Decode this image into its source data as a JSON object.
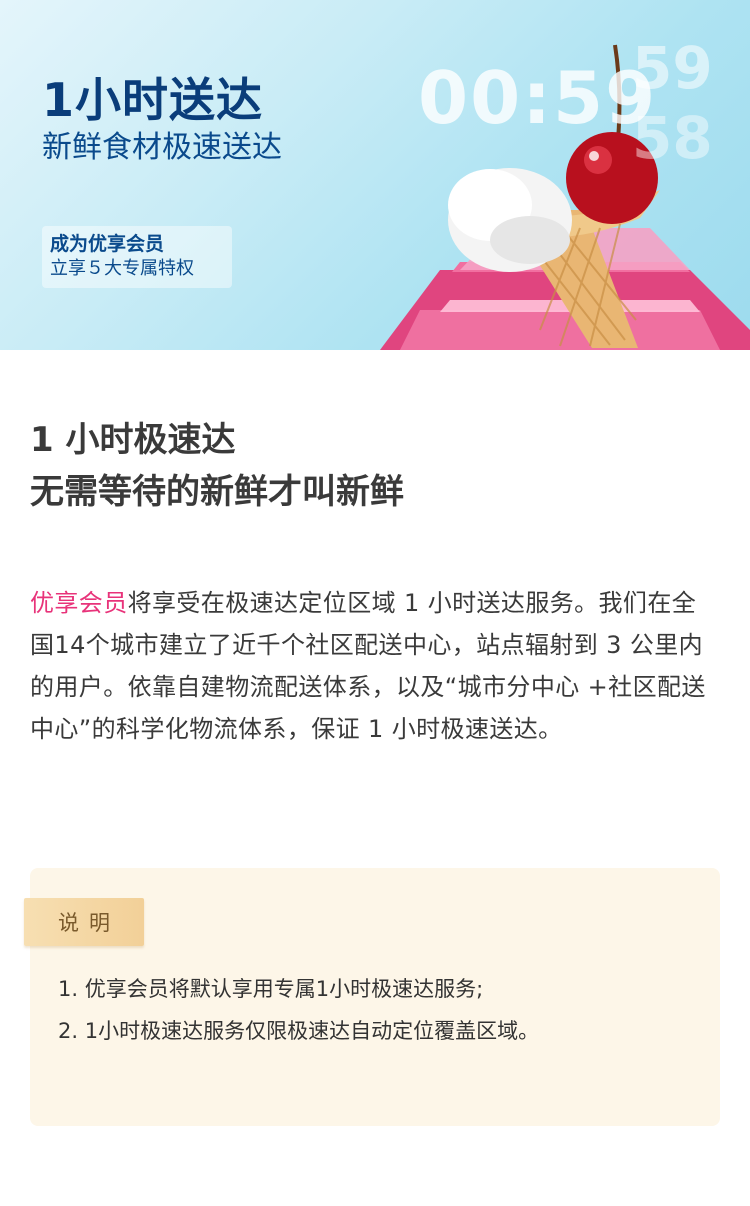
{
  "hero": {
    "title": "1小时送达",
    "subtitle": "新鲜食材极速送达",
    "member_line1": "成为优享会员",
    "member_line2": "立享５大专属特权",
    "timer": "00:59",
    "timer_next_top": "59",
    "timer_next_bottom": "58"
  },
  "main": {
    "headline_line1": "1 小时极速达",
    "headline_line2": "无需等待的新鲜才叫新鲜",
    "body_accent": "优享会员",
    "body_rest": "将享受在极速达定位区域 1 小时送达服务。我们在全国14个城市建立了近千个社区配送中心，站点辐射到 3 公里内的用户。依靠自建物流配送体系，以及“城市分中心 +社区配送中心”的科学化物流体系，保证 1 小时极速送达。"
  },
  "note": {
    "tag": "说明",
    "items": [
      "1. 优享会员将默认享用专属1小时极速达服务;",
      "2. 1小时极速达服务仅限极速达自动定位覆盖区域。"
    ]
  },
  "colors": {
    "accent": "#e8337a",
    "title_blue": "#0a3d7a",
    "note_bg": "#fdf6e8",
    "note_tag": "#f2d098"
  }
}
